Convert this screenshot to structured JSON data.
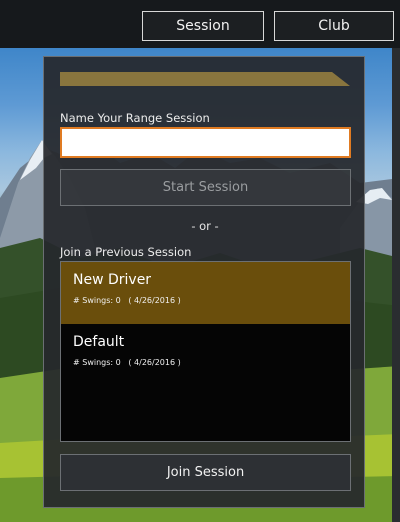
{
  "tabs": [
    {
      "label": "Session"
    },
    {
      "label": "Club"
    }
  ],
  "form": {
    "name_label": "Name Your Range Session",
    "name_value": "",
    "start_label": "Start Session",
    "or_label": "- or -",
    "previous_label": "Join a Previous Session"
  },
  "sessions": [
    {
      "name": "New Driver",
      "swings": "# Swings: 0",
      "date": "( 4/26/2016 )",
      "selected": true
    },
    {
      "name": "Default",
      "swings": "# Swings: 0",
      "date": "( 4/26/2016 )",
      "selected": false
    }
  ],
  "join_label": "Join Session",
  "colors": {
    "accent_orange": "#e07b22",
    "selected_row": "#6a4e0c",
    "banner_gold": "#9a8140"
  }
}
